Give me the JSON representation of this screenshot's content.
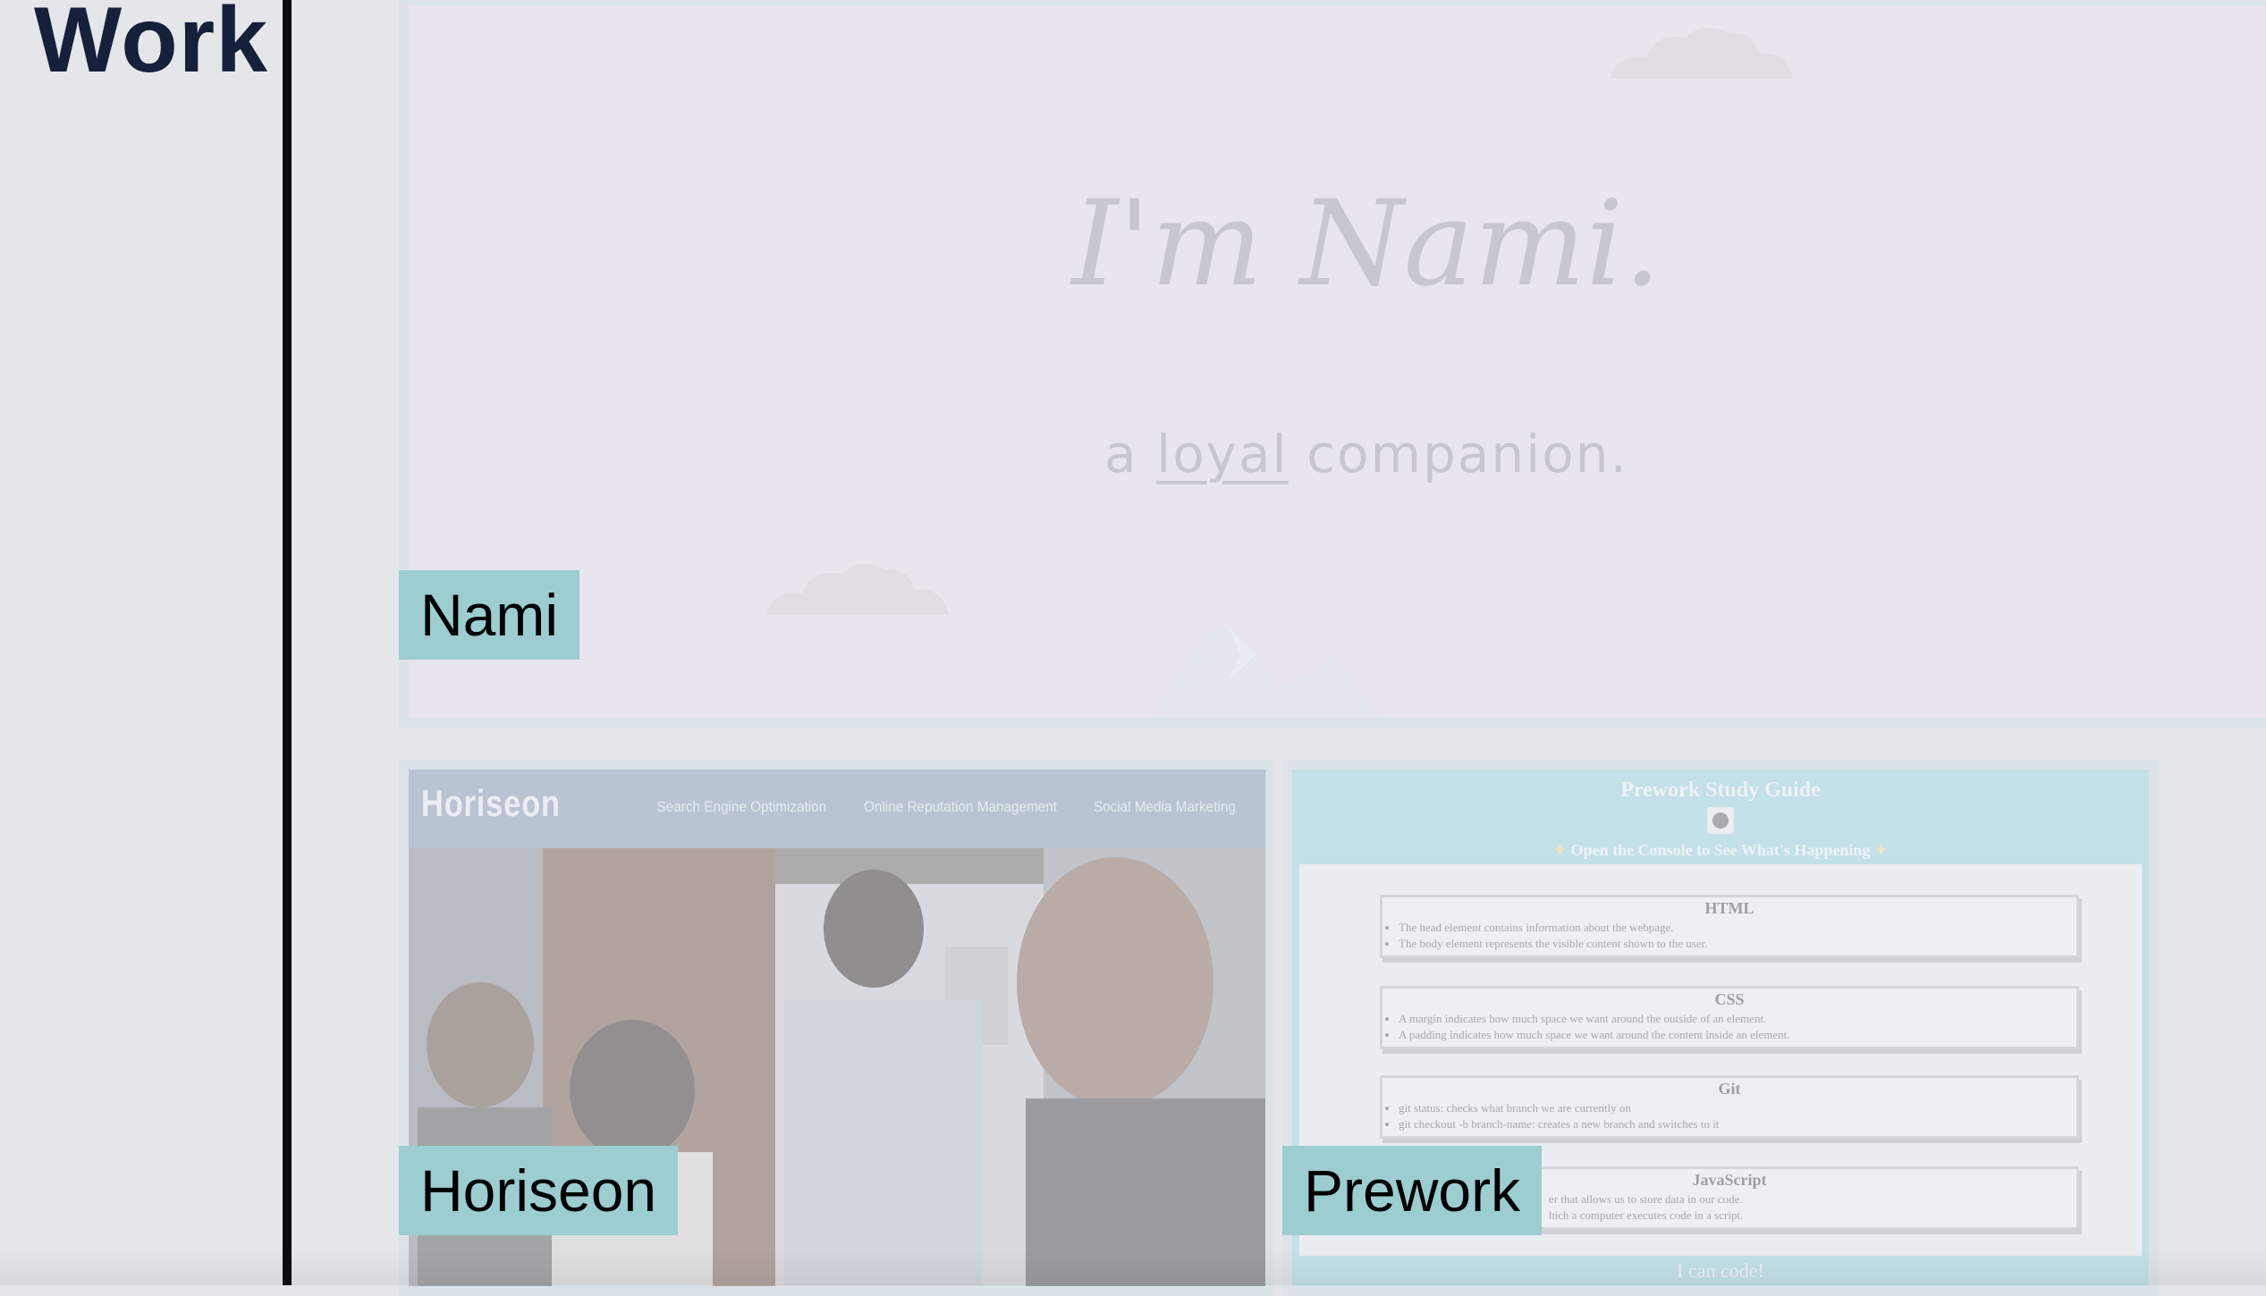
{
  "section": {
    "title": "Work"
  },
  "projects": {
    "nami": {
      "label": "Nami",
      "heading": "I'm Nami.",
      "tagline_pre": "a",
      "tagline_link": "loyal",
      "tagline_post": "companion."
    },
    "horiseon": {
      "label": "Horiseon",
      "logo": "Horiseon",
      "nav": [
        "Search Engine Optimization",
        "Online Reputation Management",
        "Social Media Marketing"
      ]
    },
    "prework": {
      "label": "Prework",
      "title": "Prework Study Guide",
      "console_text": "Open the Console to See What's Happening",
      "topics": [
        {
          "name": "HTML",
          "items": [
            "The head element contains information about the webpage.",
            "The body element represents the visible content shown to the user."
          ]
        },
        {
          "name": "CSS",
          "items": [
            "A margin indicates how much space we want around the outside of an element.",
            "A padding indicates how much space we want around the content inside an element."
          ]
        },
        {
          "name": "Git",
          "items": [
            "git status: checks what branch we are currently on",
            "git checkout -b branch-name: creates a new branch and switches to it"
          ]
        },
        {
          "name": "JavaScript",
          "items": [
            "er that allows us to store data in our code.",
            "hich a computer executes code in a script."
          ]
        }
      ],
      "footer": "I can code!"
    }
  },
  "colors": {
    "label_bg": "#9ccdd0",
    "card_border": "#cfdde2",
    "title": "#15203a"
  }
}
